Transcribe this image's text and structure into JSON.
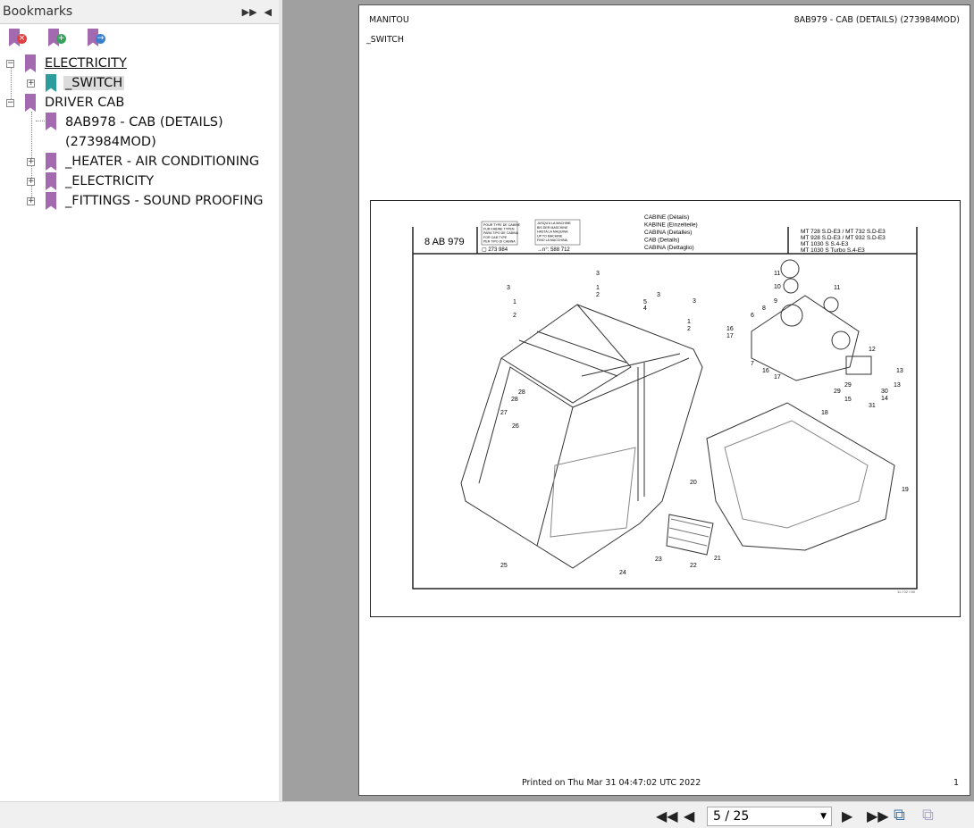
{
  "sidebar": {
    "title": "Bookmarks",
    "tree": [
      {
        "label": "ELECTRICITY"
      },
      {
        "label": "_SWITCH"
      },
      {
        "label": "DRIVER CAB"
      },
      {
        "label": "8AB978 - CAB (DETAILS)",
        "label2": "(273984MOD)"
      },
      {
        "label": "_HEATER - AIR CONDITIONING"
      },
      {
        "label": "_ELECTRICITY"
      },
      {
        "label": "_FITTINGS - SOUND PROOFING"
      }
    ]
  },
  "page": {
    "header_left": "MANITOU",
    "header_right": "8AB979 - CAB (DETAILS) (273984MOD)",
    "section": "_SWITCH",
    "footer_printed": "Printed on  Thu Mar 31 04:47:02 UTC 2022",
    "page_number": "1"
  },
  "drawing": {
    "ref": "8 AB 979",
    "box1": [
      "POUR TYPE DE CABINE",
      "FUR KABINE TYPEN",
      "PARA TIPO DE CABINA",
      "FOR CAB TYPE",
      "PER TIPO DI CABINA"
    ],
    "box1_num": "▢ 273 984",
    "box2": [
      "JUSQU'A LA MACHINE",
      "BIS DER MASCHINE",
      "HASTA LA MAQUINA",
      "UP TO MACHINE",
      "FINO LA MACCHINA"
    ],
    "box2_num": "→n°: 588 712",
    "titles": [
      "CABINE (Détails)",
      "KABINE (Einzelteile)",
      "CABINA (Detalles)",
      "CAB (Details)",
      "CABINA (Dettaglio)"
    ],
    "models": [
      "MT 728 S.D-E3 / MT 732 S.D-E3",
      "MT 928 S.D-E3 / MT 932 S.D-E3",
      "MT 1030 S S.4-E3",
      "MT 1030 S Turbo S.4-E3"
    ],
    "date": "11 / 02 / 08",
    "callouts": [
      "3",
      "1",
      "2",
      "3",
      "1",
      "2",
      "5",
      "4",
      "3",
      "3",
      "1",
      "2",
      "28",
      "28",
      "27",
      "26",
      "25",
      "24",
      "23",
      "22",
      "21",
      "20",
      "19",
      "18",
      "11",
      "10",
      "11",
      "9",
      "8",
      "6",
      "16",
      "17",
      "7",
      "16",
      "17",
      "12",
      "13",
      "13",
      "30",
      "14",
      "15",
      "31",
      "29",
      "29"
    ]
  },
  "toolbar": {
    "page_value": "5 / 25"
  }
}
